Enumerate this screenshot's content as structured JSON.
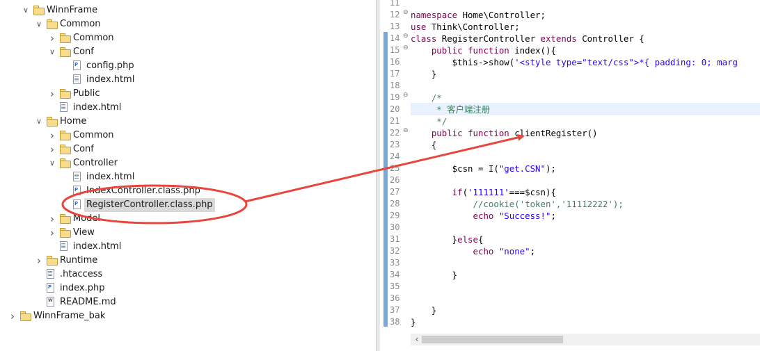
{
  "tree": {
    "items": [
      {
        "label": "WinnFrame",
        "type": "folder",
        "expanded": true
      },
      {
        "label": "Common",
        "type": "folder",
        "expanded": true
      },
      {
        "label": "Common",
        "type": "folder",
        "expanded": false
      },
      {
        "label": "Conf",
        "type": "folder",
        "expanded": true
      },
      {
        "label": "config.php",
        "type": "php"
      },
      {
        "label": "index.html",
        "type": "html"
      },
      {
        "label": "Public",
        "type": "folder",
        "expanded": false
      },
      {
        "label": "index.html",
        "type": "html"
      },
      {
        "label": "Home",
        "type": "folder",
        "expanded": true
      },
      {
        "label": "Common",
        "type": "folder",
        "expanded": false
      },
      {
        "label": "Conf",
        "type": "folder",
        "expanded": false
      },
      {
        "label": "Controller",
        "type": "folder",
        "expanded": true
      },
      {
        "label": "index.html",
        "type": "html"
      },
      {
        "label": "IndexController.class.php",
        "type": "php"
      },
      {
        "label": "RegisterController.class.php",
        "type": "php",
        "selected": true
      },
      {
        "label": "Model",
        "type": "folder",
        "expanded": false
      },
      {
        "label": "View",
        "type": "folder",
        "expanded": false
      },
      {
        "label": "index.html",
        "type": "html"
      },
      {
        "label": "Runtime",
        "type": "folder",
        "expanded": false
      },
      {
        "label": ".htaccess",
        "type": "file"
      },
      {
        "label": "index.php",
        "type": "php"
      },
      {
        "label": "README.md",
        "type": "md"
      },
      {
        "label": "WinnFrame_bak",
        "type": "folder",
        "expanded": false
      }
    ]
  },
  "editor": {
    "line_numbers": [
      "11",
      "12",
      "13",
      "14",
      "15",
      "16",
      "17",
      "18",
      "19",
      "20",
      "21",
      "22",
      "23",
      "24",
      "25",
      "26",
      "27",
      "28",
      "29",
      "30",
      "31",
      "32",
      "33",
      "34",
      "35",
      "36",
      "37",
      "38"
    ],
    "fold_lines": [
      "12",
      "14",
      "15",
      "19",
      "22"
    ],
    "lines": [
      [],
      [
        {
          "t": "namespace",
          "c": "kw"
        },
        {
          "t": " Home\\Controller;"
        }
      ],
      [
        {
          "t": "use",
          "c": "kw"
        },
        {
          "t": " Think\\Controller;"
        }
      ],
      [
        {
          "t": "class",
          "c": "kw"
        },
        {
          "t": " RegisterController "
        },
        {
          "t": "extends",
          "c": "kw"
        },
        {
          "t": " Controller {"
        }
      ],
      [
        {
          "t": "    "
        },
        {
          "t": "public",
          "c": "kw"
        },
        {
          "t": " "
        },
        {
          "t": "function",
          "c": "kw"
        },
        {
          "t": " index(){"
        }
      ],
      [
        {
          "t": "        $this->show("
        },
        {
          "t": "'<style type=\"text/css\">*{ padding: 0; marg",
          "c": "str"
        }
      ],
      [
        {
          "t": "    }"
        }
      ],
      [],
      [
        {
          "t": "    /*",
          "c": "cm"
        }
      ],
      [
        {
          "t": "     * 客户端注册",
          "c": "cm"
        }
      ],
      [
        {
          "t": "     */",
          "c": "cm"
        }
      ],
      [
        {
          "t": "    "
        },
        {
          "t": "public",
          "c": "kw"
        },
        {
          "t": " "
        },
        {
          "t": "function",
          "c": "kw"
        },
        {
          "t": " clientRegister()"
        }
      ],
      [
        {
          "t": "    {"
        }
      ],
      [],
      [
        {
          "t": "        $csn = I("
        },
        {
          "t": "\"get.CSN\"",
          "c": "str"
        },
        {
          "t": ");"
        }
      ],
      [],
      [
        {
          "t": "        "
        },
        {
          "t": "if",
          "c": "kw"
        },
        {
          "t": "("
        },
        {
          "t": "'111111'",
          "c": "str"
        },
        {
          "t": "===$csn){"
        }
      ],
      [
        {
          "t": "            //cookie('token','11112222');",
          "c": "cm"
        }
      ],
      [
        {
          "t": "            "
        },
        {
          "t": "echo",
          "c": "kw"
        },
        {
          "t": " "
        },
        {
          "t": "\"Success!\"",
          "c": "str"
        },
        {
          "t": ";"
        }
      ],
      [],
      [
        {
          "t": "        }"
        },
        {
          "t": "else",
          "c": "kw"
        },
        {
          "t": "{"
        }
      ],
      [
        {
          "t": "            "
        },
        {
          "t": "echo",
          "c": "kw"
        },
        {
          "t": " "
        },
        {
          "t": "\"none\"",
          "c": "str"
        },
        {
          "t": ";"
        }
      ],
      [],
      [
        {
          "t": "        }"
        }
      ],
      [],
      [],
      [
        {
          "t": "    }"
        }
      ],
      [
        {
          "t": "}"
        }
      ]
    ],
    "current_line": "20"
  },
  "annotation": {
    "color": "#e8453c"
  }
}
